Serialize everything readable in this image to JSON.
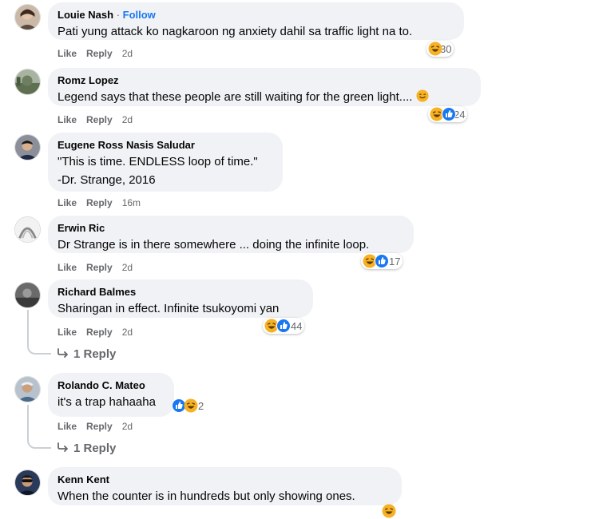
{
  "comments": [
    {
      "name": "Louie Nash",
      "follow": "Follow",
      "text": "Pati yung attack ko nagkaroon ng anxiety dahil sa traffic light na to.",
      "like": "Like",
      "reply": "Reply",
      "time": "2d",
      "reactions": [
        "haha"
      ],
      "count": "30"
    },
    {
      "name": "Romz Lopez",
      "text": "Legend says that these people are still waiting for the green light....",
      "like": "Like",
      "reply": "Reply",
      "time": "2d",
      "reactions": [
        "haha",
        "like"
      ],
      "count": "24"
    },
    {
      "name": "Eugene Ross Nasis Saludar",
      "text_lines": [
        "\"This is time. ENDLESS loop of time.\"",
        "-Dr. Strange, 2016"
      ],
      "like": "Like",
      "reply": "Reply",
      "time": "16m"
    },
    {
      "name": "Erwin Ric",
      "text": "Dr Strange is in there somewhere ... doing the infinite loop.",
      "like": "Like",
      "reply": "Reply",
      "time": "2d",
      "reactions": [
        "haha",
        "like"
      ],
      "count": "17"
    },
    {
      "name": "Richard Balmes",
      "text": "Sharingan in effect. Infinite tsukoyomi yan",
      "like": "Like",
      "reply": "Reply",
      "time": "2d",
      "reactions": [
        "haha",
        "like"
      ],
      "count": "44",
      "replies": "1 Reply"
    },
    {
      "name": "Rolando C. Mateo",
      "text": "it's a trap hahaaha",
      "like": "Like",
      "reply": "Reply",
      "time": "2d",
      "reactions": [
        "like",
        "haha"
      ],
      "count": "2",
      "replies": "1 Reply"
    },
    {
      "name": "Kenn Kent",
      "text": "When the counter is in hundreds but only showing ones.",
      "reactions": [
        "haha"
      ]
    }
  ],
  "colors": {
    "link": "#1877f2",
    "bubble": "#f0f2f5",
    "meta": "#65676b",
    "haha": "#f7b125",
    "like": "#1877f2"
  }
}
